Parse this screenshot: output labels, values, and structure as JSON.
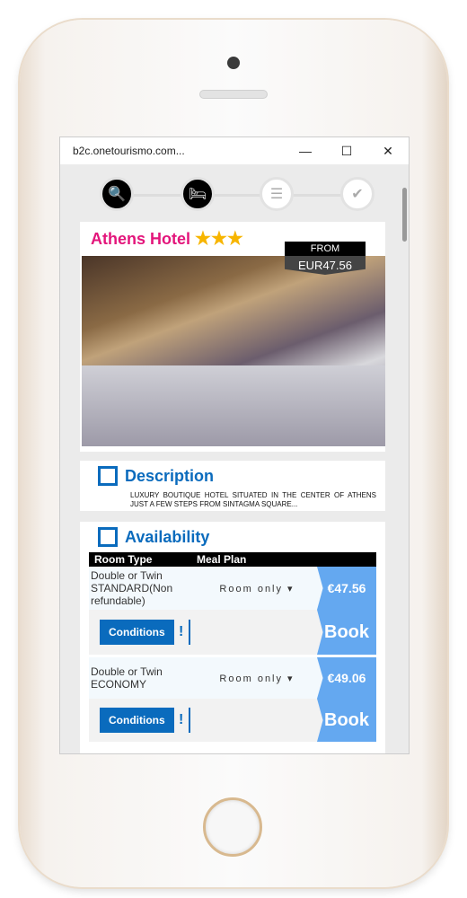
{
  "window": {
    "title": "b2c.onetourismo.com...",
    "minimize": "—",
    "maximize": "☐",
    "close": "✕"
  },
  "steps": [
    {
      "icon": "search-icon",
      "glyph": "🔍"
    },
    {
      "icon": "bed-icon",
      "glyph": "🛏"
    },
    {
      "icon": "list-icon",
      "glyph": "☰"
    },
    {
      "icon": "check-icon",
      "glyph": "✔"
    }
  ],
  "hotel": {
    "name": "Athens Hotel",
    "stars": "★★★",
    "star_count": 3,
    "from_label": "FROM",
    "from_price": "EUR47.56"
  },
  "description": {
    "title": "Description",
    "text": "Luxury boutique hotel situated in the center of Athens just a few steps from Sintagma Square..."
  },
  "availability": {
    "title": "Availability",
    "headers": {
      "room_type": "Room Type",
      "meal_plan": "Meal Plan"
    },
    "rooms": [
      {
        "type": "Double or Twin STANDARD(Non refundable)",
        "meal": "Room only ▾",
        "price": "€47.56",
        "conditions": "Conditions",
        "info": "!",
        "book": "Book"
      },
      {
        "type": "Double or Twin ECONOMY",
        "meal": "Room only ▾",
        "price": "€49.06",
        "conditions": "Conditions",
        "info": "!",
        "book": "Book"
      }
    ]
  },
  "colors": {
    "accent": "#0a6bbd",
    "hotel_name": "#e3157b",
    "price": "#64a8f0",
    "star": "#f7b500"
  }
}
